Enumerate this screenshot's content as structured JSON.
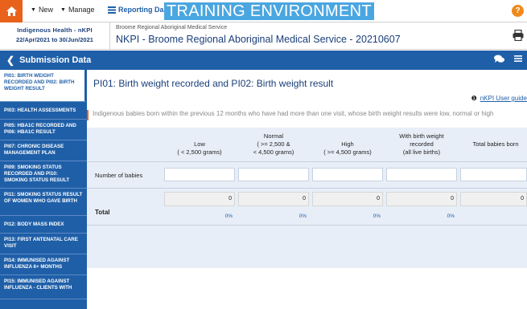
{
  "topbar": {
    "new_label": "New",
    "manage_label": "Manage",
    "dashboard_label": "Reporting Dashboard",
    "env_label": "TRAINING ENVIRONMENT",
    "help_label": "?"
  },
  "header": {
    "org_line1": "Indigenous Health - nKPI",
    "org_line2": "22/Apr/2021 to 30/Jun/2021",
    "service_sub": "Broome Regional Aboriginal Medical Service",
    "service_title": "NKPI - Broome Regional Aboriginal Medical Service - 20210607"
  },
  "nav": {
    "title": "Submission Data"
  },
  "sidebar": {
    "items": [
      {
        "label": "PI01: Birth weight recorded and PI02: Birth weight result",
        "active": true
      },
      {
        "label": "PI03: Health assessments",
        "active": false
      },
      {
        "label": "PI05: HbA1c recorded and PI06: HbA1c result",
        "active": false
      },
      {
        "label": "PI07: Chronic disease management plan",
        "active": false
      },
      {
        "label": "PI09: Smoking status recorded and PI10: Smoking status result",
        "active": false
      },
      {
        "label": "PI11: Smoking status result of women who gave birth",
        "active": false
      },
      {
        "label": "PI12: Body mass index",
        "active": false
      },
      {
        "label": "PI13: First antenatal care visit",
        "active": false
      },
      {
        "label": "PI14: Immunised against influenza 6+ months",
        "active": false
      },
      {
        "label": "PI15: Immunised against influenza - clients with",
        "active": false
      }
    ]
  },
  "main": {
    "page_title": "PI01: Birth weight recorded and PI02: Birth weight result",
    "guide_link": "nKPI User guide",
    "description": "Indigenous babies born within the previous 12 months who have had more than one visit, whose birth weight results were low, normal or high",
    "columns": [
      {
        "line1": "",
        "line2": "Low",
        "line3": "( < 2,500 grams)"
      },
      {
        "line1": "Normal",
        "line2": "( >= 2,500 &",
        "line3": "< 4,500 grams)"
      },
      {
        "line1": "",
        "line2": "High",
        "line3": "( >= 4,500 grams)"
      },
      {
        "line1": "With birth weight",
        "line2": "recorded",
        "line3": "(all live births)"
      },
      {
        "line1": "",
        "line2": "",
        "line3": "Total babies born"
      }
    ],
    "row_label": "Number of babies",
    "total_label": "Total",
    "totals": [
      "0",
      "0",
      "0",
      "0",
      "0"
    ],
    "percents": [
      "0%",
      "0%",
      "0%",
      "0%"
    ]
  }
}
